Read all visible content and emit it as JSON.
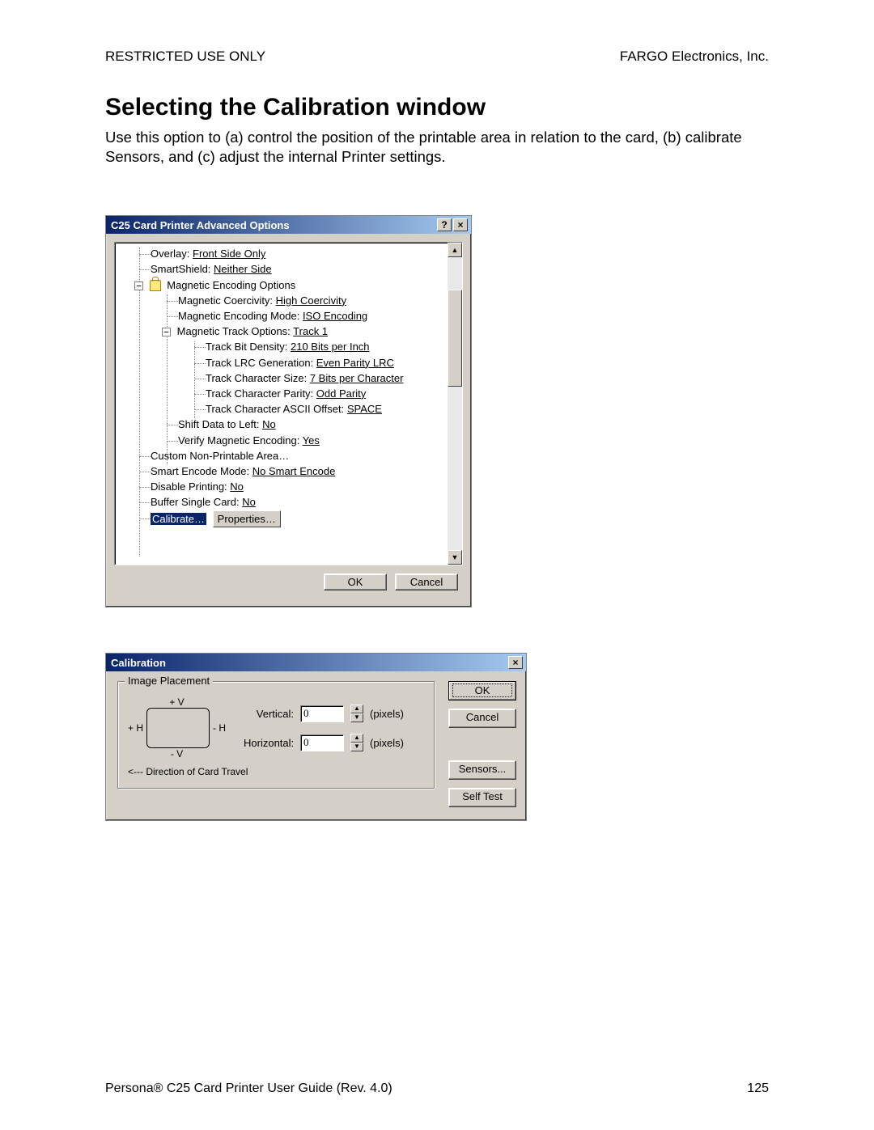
{
  "header": {
    "left": "RESTRICTED USE ONLY",
    "right": "FARGO Electronics, Inc."
  },
  "title": "Selecting the Calibration window",
  "intro": "Use this option to (a) control the position of the printable area in relation to the card, (b) calibrate Sensors, and (c) adjust the internal Printer settings.",
  "dlg1": {
    "title": "C25 Card Printer Advanced Options",
    "tree": {
      "overlay": {
        "label": "Overlay: ",
        "value": "Front Side Only"
      },
      "smartshield": {
        "label": "SmartShield: ",
        "value": "Neither Side"
      },
      "magopt": {
        "label": "Magnetic Encoding Options"
      },
      "coercivity": {
        "label": "Magnetic Coercivity: ",
        "value": "High Coercivity"
      },
      "encmode": {
        "label": "Magnetic Encoding Mode: ",
        "value": "ISO Encoding"
      },
      "trackopt": {
        "label": "Magnetic Track Options: ",
        "value": "Track 1"
      },
      "bitdensity": {
        "label": "Track Bit Density: ",
        "value": "210 Bits per Inch"
      },
      "lrc": {
        "label": "Track LRC Generation: ",
        "value": "Even Parity LRC"
      },
      "charsize": {
        "label": "Track Character Size: ",
        "value": "7 Bits per Character"
      },
      "charparity": {
        "label": "Track Character Parity: ",
        "value": "Odd Parity"
      },
      "ascii": {
        "label": "Track Character ASCII Offset: ",
        "value": "SPACE"
      },
      "shift": {
        "label": "Shift Data to Left: ",
        "value": "No"
      },
      "verify": {
        "label": "Verify Magnetic Encoding: ",
        "value": "Yes"
      },
      "customnpa": {
        "label": "Custom Non-Printable Area…"
      },
      "smenc": {
        "label": "Smart Encode Mode: ",
        "value": "No Smart Encode"
      },
      "disable": {
        "label": "Disable Printing: ",
        "value": "No"
      },
      "buffer": {
        "label": "Buffer Single Card: ",
        "value": "No"
      },
      "calibrate": {
        "label": "Calibrate…"
      },
      "properties": {
        "label": "Properties…"
      }
    },
    "buttons": {
      "ok": "OK",
      "cancel": "Cancel"
    }
  },
  "dlg2": {
    "title": "Calibration",
    "group": "Image Placement",
    "labels": {
      "plusV": "+ V",
      "minusV": "- V",
      "plusH": "+ H",
      "minusH": "- H",
      "vertical": "Vertical:",
      "horizontal": "Horizontal:",
      "pixels": "(pixels)",
      "direction": "<--- Direction of Card Travel"
    },
    "values": {
      "vertical": "0",
      "horizontal": "0"
    },
    "buttons": {
      "ok": "OK",
      "cancel": "Cancel",
      "sensors": "Sensors...",
      "selftest": "Self Test"
    }
  },
  "footer": {
    "left": "Persona® C25 Card Printer User Guide (Rev. 4.0)",
    "right": "125"
  }
}
